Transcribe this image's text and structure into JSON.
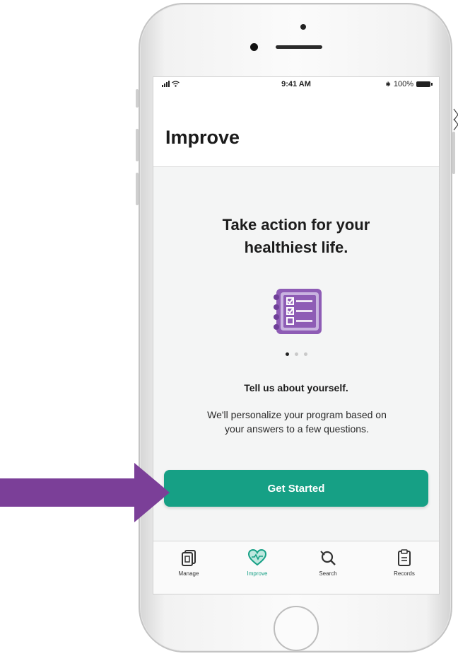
{
  "status_bar": {
    "time": "9:41 AM",
    "battery_text": "100%",
    "bluetooth_glyph": "✱"
  },
  "page": {
    "title": "Improve",
    "headline_line1": "Take action for your",
    "headline_line2": "healthiest life.",
    "carousel": {
      "total": 3,
      "active_index": 0
    },
    "subheading": "Tell us about yourself.",
    "body_line1": "We'll personalize your program based on",
    "body_line2": "your answers to a few questions.",
    "cta_label": "Get Started"
  },
  "tab_bar": {
    "tabs": [
      {
        "label": "Manage",
        "icon": "manage-icon",
        "active": false
      },
      {
        "label": "Improve",
        "icon": "heart-icon",
        "active": true
      },
      {
        "label": "Search",
        "icon": "search-icon",
        "active": false
      },
      {
        "label": "Records",
        "icon": "clipboard-icon",
        "active": false
      }
    ]
  },
  "colors": {
    "accent": "#16a085",
    "arrow": "#7b3f98",
    "illustration": "#8e5cb5",
    "content_background": "#f4f5f5"
  },
  "annotation": {
    "arrow_target": "get-started-button"
  }
}
